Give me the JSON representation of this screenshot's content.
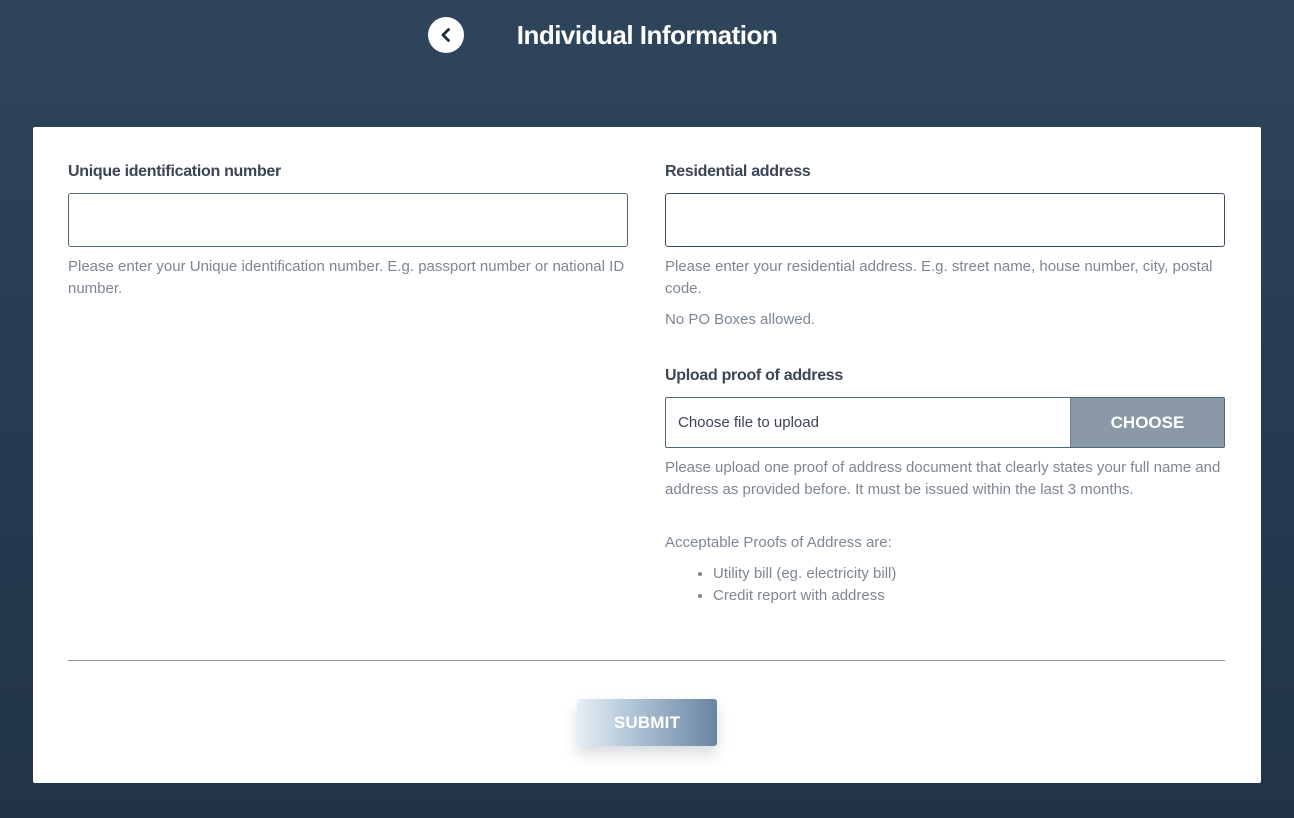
{
  "header": {
    "title": "Individual Information",
    "back_icon": "chevron-left-icon"
  },
  "form": {
    "uin": {
      "label": "Unique identification number",
      "value": "",
      "help": "Please enter your Unique identification number. E.g. passport number or national ID number."
    },
    "address": {
      "label": "Residential address",
      "value": "",
      "help": "Please enter your residential address. E.g. street name, house number, city, postal code.",
      "note": "No PO Boxes allowed."
    },
    "proof": {
      "label": "Upload proof of address",
      "placeholder": "Choose file to upload",
      "button_label": "CHOOSE",
      "help": "Please upload one proof of address document that clearly states your full name and address as provided before. It must be issued within the last 3 months.",
      "acceptable_title": "Acceptable Proofs of Address are:",
      "acceptable": [
        "Utility bill (eg. electricity bill)",
        "Credit report with address"
      ]
    },
    "submit_label": "SUBMIT"
  },
  "colors": {
    "background_top": "#2f455c",
    "background_bottom": "#213447",
    "card": "#ffffff",
    "choose_button": "#8a98a7",
    "help_text": "#7b8793",
    "label_text": "#3a4656"
  }
}
